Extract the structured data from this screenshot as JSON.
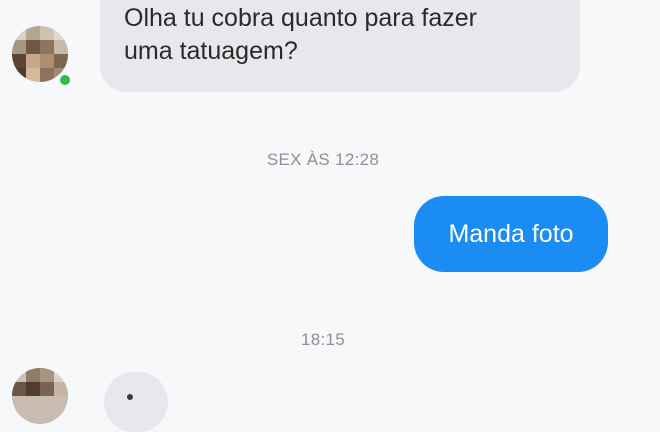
{
  "messages": {
    "incoming_1": "Olha tu cobra quanto para fazer\numa tatuagem?",
    "timestamp_1": "SEX ÀS 12:28",
    "outgoing_1": "Manda foto",
    "timestamp_2": "18:15"
  },
  "colors": {
    "incoming_bubble": "#e7e8ec",
    "outgoing_bubble": "#1a8cf3",
    "online_indicator": "#2fbb4f",
    "timestamp_text": "#8d9096"
  },
  "icons": {
    "online": "online-status-dot"
  }
}
